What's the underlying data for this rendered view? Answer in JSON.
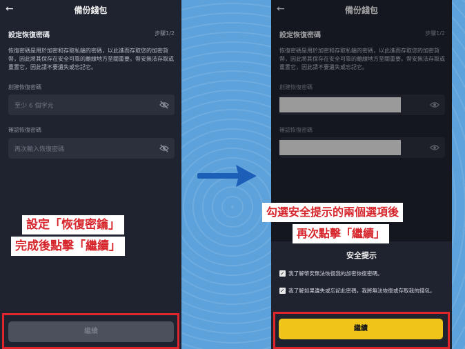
{
  "left": {
    "header_title": "備份錢包",
    "back_icon": "arrow-left-icon",
    "section_title": "設定恢復密碼",
    "step": "步驟1/2",
    "description": "恢復密碼是用於加密和存取私鑰的密碼，以此進而存取您的加密貨幣，因此將其保存在安全可靠的離線地方至關重要。幣安無法存取或重置它，因此請不要遺失或忘記它。",
    "create_label": "創建恢復密碼",
    "create_placeholder": "至少 6 個字元",
    "confirm_label": "確認恢復密碼",
    "confirm_placeholder": "再次輸入恢復密碼",
    "continue_label": "繼續",
    "annotation_line1": "設定「恢復密鑰」",
    "annotation_line2": "完成後點擊「繼續」"
  },
  "right": {
    "header_title": "備份錢包",
    "section_title": "設定恢復密碼",
    "step": "步驟1/2",
    "description": "恢復密碼是用於加密和存取私鑰的密碼，以此進而存取您的加密貨幣，因此將其保存在安全可靠的離線地方至關重要。幣安無法存取或重置它，因此請不要遺失或忘記它。",
    "create_label": "創建恢復密碼",
    "confirm_label": "確認恢復密碼",
    "annotation_line1": "勾選安全提示的兩個選項後",
    "annotation_line2": "再次點擊「繼續」",
    "sheet_title": "安全提示",
    "check1": "我了解幣安無法恢復我的加密恢復密碼。",
    "check2": "我了解如果遺失或忘記此密碼，我將無法恢復或存取我的錢包。",
    "continue_label": "繼續"
  },
  "colors": {
    "annotation_red": "#e0262c",
    "button_yellow": "#f0c419",
    "phone_bg": "#1f2330",
    "page_bg": "#5ea2db"
  }
}
